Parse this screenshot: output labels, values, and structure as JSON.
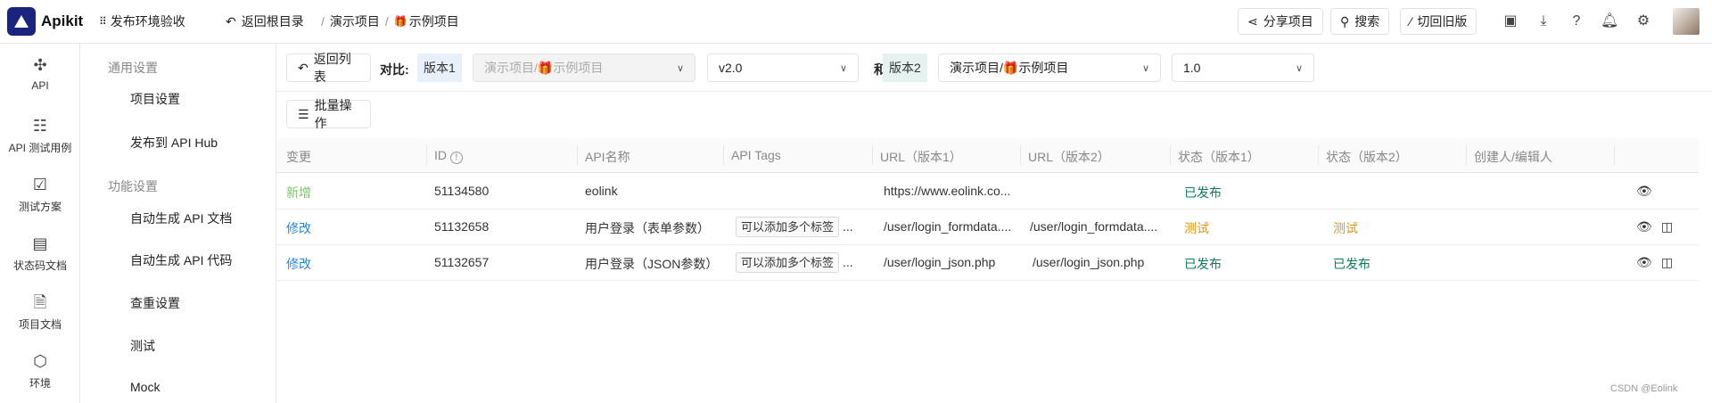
{
  "header": {
    "brand": "Apikit",
    "workspace": "发布环境验收",
    "back_root": "返回根目录",
    "breadcrumb": [
      "演示项目",
      "示例项目"
    ],
    "share": "分享项目",
    "search": "搜索",
    "switch_old": "切回旧版"
  },
  "icon_sidebar": [
    {
      "label": "API",
      "icon": "api-icon"
    },
    {
      "label": "API 测试用例",
      "icon": "test-case-icon"
    },
    {
      "label": "测试方案",
      "icon": "test-plan-icon"
    },
    {
      "label": "状态码文档",
      "icon": "status-code-icon"
    },
    {
      "label": "项目文档",
      "icon": "doc-icon"
    },
    {
      "label": "环境",
      "icon": "env-icon"
    }
  ],
  "settings_menu": {
    "group1": "通用设置",
    "items1": [
      "项目设置",
      "发布到 API Hub"
    ],
    "group2": "功能设置",
    "items2": [
      "自动生成 API 文档",
      "自动生成 API 代码",
      "查重设置",
      "测试",
      "Mock"
    ]
  },
  "toolbar": {
    "back_list": "返回列表",
    "compare_label": "对比:",
    "v1_tag": "版本1",
    "v1_project": "演示项目/🎁示例项目",
    "v1_version": "v2.0",
    "and": "和",
    "v2_tag": "版本2",
    "v2_project": "演示项目/🎁示例项目",
    "v2_version": "1.0",
    "batch": "批量操作"
  },
  "table": {
    "headers": [
      "变更",
      "ID",
      "API名称",
      "API Tags",
      "URL（版本1）",
      "URL（版本2）",
      "状态（版本1）",
      "状态（版本2）",
      "创建人/编辑人"
    ],
    "rows": [
      {
        "change": "新增",
        "id": "51134580",
        "name": "eolink",
        "tag": "",
        "more": "",
        "url1": "https://www.eolink.co...",
        "url2": "",
        "s1": "已发布",
        "s2": ""
      },
      {
        "change": "修改",
        "id": "51132658",
        "name": "用户登录（表单参数）",
        "tag": "可以添加多个标签",
        "more": "...",
        "url1": "/user/login_formdata....",
        "url2": "/user/login_formdata....",
        "s1": "测试",
        "s2": "测试"
      },
      {
        "change": "修改",
        "id": "51132657",
        "name": "用户登录（JSON参数）",
        "tag": "可以添加多个标签",
        "more": "...",
        "url1": "/user/login_json.php",
        "url2": "/user/login_json.php",
        "s1": "已发布",
        "s2": "已发布"
      }
    ]
  },
  "footer": "CSDN @Eolink",
  "colors": {
    "added": "#7cc46a",
    "modified": "#1e88e5",
    "published": "#0a7d55",
    "testing": "#e8951c",
    "brand": "#1a237e"
  }
}
